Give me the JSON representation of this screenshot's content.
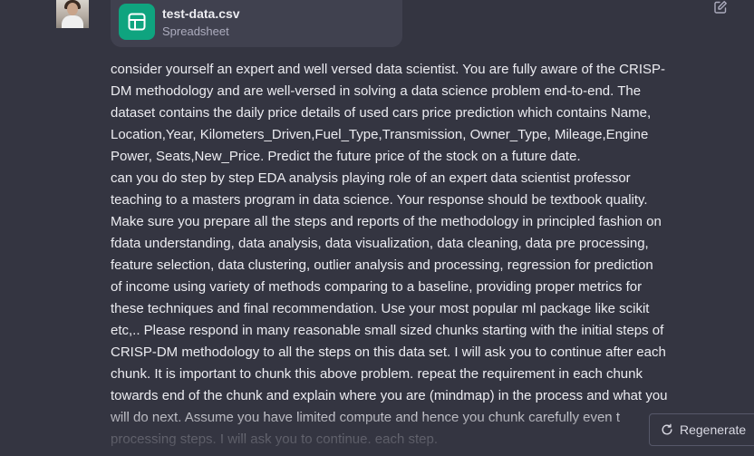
{
  "file": {
    "name": "test-data.csv",
    "type": "Spreadsheet",
    "icon": "spreadsheet-icon",
    "icon_color": "#0fa47f"
  },
  "edit_icon": "edit-icon",
  "prompt_lines": [
    "consider yourself an expert and well versed data scientist. You are fully aware of the CRISP-",
    "DM methodology and are well-versed in solving a data science problem end-to-end.  The",
    "dataset contains the daily price details of used cars price prediction which contains  Name,",
    "Location,Year,  Kilometers_Driven,Fuel_Type,Transmission,  Owner_Type, Mileage,Engine",
    "Power,  Seats,New_Price. Predict the future price of the stock on a future date.",
    "can you do step by step EDA analysis playing role of an expert data scientist professor",
    "teaching to a masters program in data science. Your response should be textbook quality.",
    "Make sure you prepare all the steps and reports of the methodology in principled fashion on",
    "fdata understanding, data analysis, data visualization, data cleaning, data pre processing,",
    "feature selection, data clustering, outlier analysis and processing, regression for prediction",
    "of income using variety of methods comparing to a baseline, providing proper metrics for",
    "these techniques and final recommendation. Use your most popular ml package like scikit",
    "etc,.. Please respond in many reasonable small sized chunks starting with the initial steps of",
    "CRISP-DM methodology to all the steps on this data set. I will ask you to continue after each",
    "chunk. It is important to chunk this above problem. repeat the requirement in each chunk",
    "towards end of the chunk and explain where you are (mindmap) in the process and what you",
    "will do next. Assume you have limited compute and hence you chunk carefully even t",
    "processing steps. I will ask you to continue. each step."
  ],
  "regenerate": {
    "label": "Regenerate",
    "icon": "refresh-icon"
  }
}
